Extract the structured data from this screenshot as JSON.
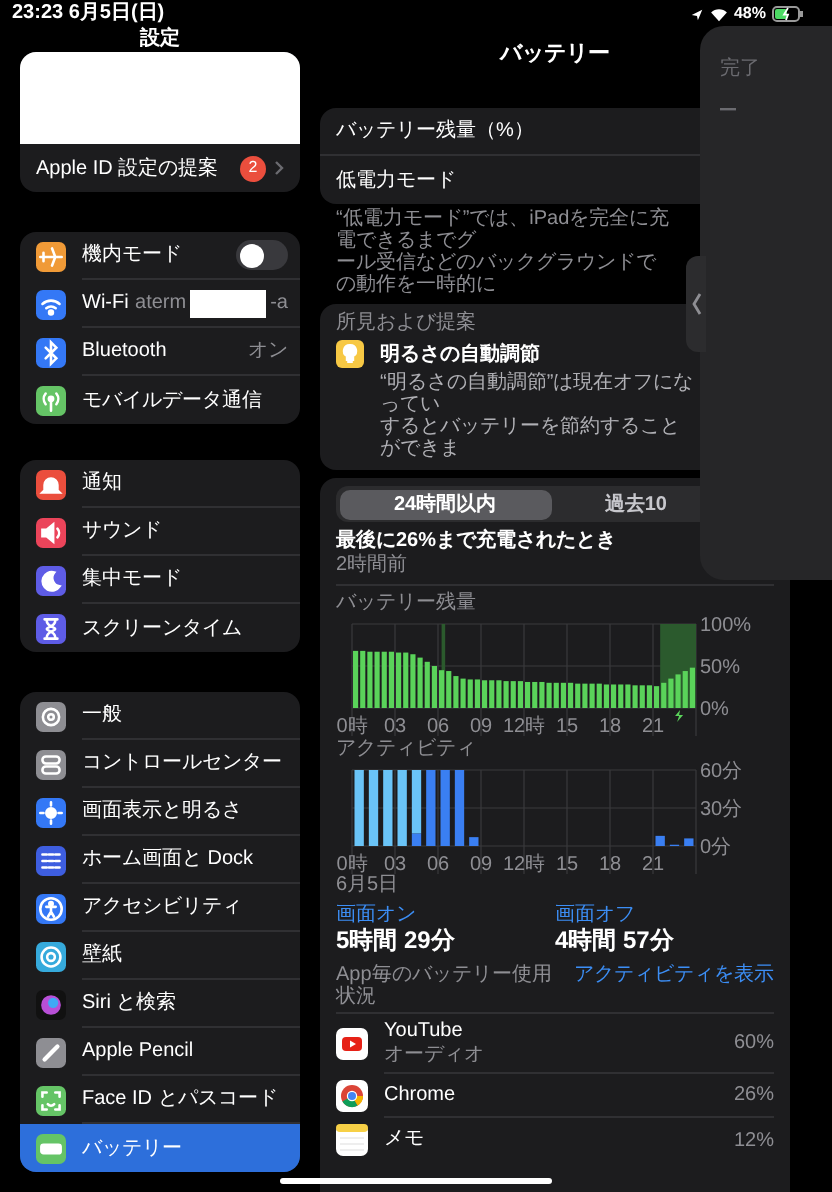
{
  "status_bar": {
    "datetime": "23:23 6月5日(日)",
    "battery": "48%"
  },
  "sidebar": {
    "title": "設定",
    "apple_id": {
      "label": "Apple ID 設定の提案",
      "badge": "2"
    },
    "groups": [
      {
        "items": [
          {
            "label": "機内モード",
            "kind": "toggle",
            "on": false,
            "selected": false
          },
          {
            "label": "Wi-Fi",
            "kind": "redacted_value",
            "value_start": "aterm",
            "value_end": "-a",
            "selected": false
          },
          {
            "label": "Bluetooth",
            "kind": "value",
            "value": "オン",
            "selected": false
          },
          {
            "label": "モバイルデータ通信",
            "kind": "plain",
            "selected": false
          }
        ]
      },
      {
        "items": [
          {
            "label": "通知",
            "kind": "plain",
            "selected": false
          },
          {
            "label": "サウンド",
            "kind": "plain",
            "selected": false
          },
          {
            "label": "集中モード",
            "kind": "plain",
            "selected": false
          },
          {
            "label": "スクリーンタイム",
            "kind": "plain",
            "selected": false
          }
        ]
      },
      {
        "items": [
          {
            "label": "一般",
            "kind": "plain",
            "selected": false
          },
          {
            "label": "コントロールセンター",
            "kind": "plain",
            "selected": false
          },
          {
            "label": "画面表示と明るさ",
            "kind": "plain",
            "selected": false
          },
          {
            "label": "ホーム画面と Dock",
            "kind": "plain",
            "selected": false
          },
          {
            "label": "アクセシビリティ",
            "kind": "plain",
            "selected": false
          },
          {
            "label": "壁紙",
            "kind": "plain",
            "selected": false
          },
          {
            "label": "Siri と検索",
            "kind": "plain",
            "selected": false
          },
          {
            "label": "Apple Pencil",
            "kind": "plain",
            "selected": false
          },
          {
            "label": "Face ID とパスコード",
            "kind": "plain",
            "selected": false
          },
          {
            "label": "バッテリー",
            "kind": "plain",
            "selected": true
          }
        ]
      }
    ]
  },
  "detail": {
    "title": "バッテリー",
    "settings": [
      {
        "label": "バッテリー残量（%）"
      },
      {
        "label": "低電力モード"
      }
    ],
    "low_power_note": [
      "“低電力モード”では、iPadを完全に充電できるまでグ",
      "ール受信などのバックグラウンドでの動作を一時的に"
    ],
    "insights": {
      "header": "所見および提案",
      "title": "明るさの自動調節",
      "text": [
        "“明るさの自動調節”は現在オフになってい",
        "するとバッテリーを節約することができま"
      ]
    },
    "usage": {
      "tabs": [
        {
          "label": "24時間以内",
          "selected": true
        },
        {
          "label": "過去10",
          "selected": false
        }
      ],
      "last_charge": "最後に26%まで充電されたとき",
      "last_charge_ago": "2時間前",
      "battery_level": {
        "chart_data": {
          "type": "bar",
          "title": "バッテリー残量",
          "grid": true,
          "xlim": [
            0,
            24
          ],
          "ylim": [
            0,
            100
          ],
          "x": [
            0.25,
            0.75,
            1.25,
            1.75,
            2.25,
            2.75,
            3.25,
            3.75,
            4.25,
            4.75,
            5.25,
            5.75,
            6.25,
            6.75,
            7.25,
            7.75,
            8.25,
            8.75,
            9.25,
            9.75,
            10.25,
            10.75,
            11.25,
            11.75,
            12.25,
            12.75,
            13.25,
            13.75,
            14.25,
            14.75,
            15.25,
            15.75,
            16.25,
            16.75,
            17.25,
            17.75,
            18.25,
            18.75,
            19.25,
            19.75,
            20.25,
            20.75,
            21.25,
            21.75,
            22.25,
            22.75,
            23.25,
            23.75
          ],
          "series": [
            {
              "color": "#5ad35a",
              "values": [
                68,
                68,
                67,
                67,
                67,
                67,
                66,
                66,
                64,
                60,
                55,
                50,
                45,
                44,
                38,
                35,
                34,
                34,
                33,
                33,
                33,
                32,
                32,
                32,
                31,
                31,
                31,
                30,
                30,
                30,
                30,
                29,
                29,
                29,
                29,
                28,
                28,
                28,
                28,
                27,
                27,
                27,
                26,
                30,
                35,
                40,
                44,
                48
              ]
            }
          ],
          "xticks": [
            {
              "value": 0,
              "label": "0時"
            },
            {
              "value": 3,
              "label": "03"
            },
            {
              "value": 6,
              "label": "06"
            },
            {
              "value": 9,
              "label": "09"
            },
            {
              "value": 12,
              "label": "12時"
            },
            {
              "value": 15,
              "label": "15"
            },
            {
              "value": 18,
              "label": "18"
            },
            {
              "value": 21,
              "label": "21"
            }
          ],
          "yticks": [
            {
              "value": 100,
              "label": "100%"
            },
            {
              "value": 50,
              "label": "50%"
            },
            {
              "value": 0,
              "label": "0%"
            }
          ],
          "bands": [
            {
              "axis": "x",
              "from": 6.25,
              "to": 6.5
            },
            {
              "axis": "x",
              "from": 21.5,
              "to": 24
            }
          ]
        }
      },
      "activity": {
        "date": "6月5日",
        "chart_data": {
          "type": "bar",
          "title": "アクティビティ",
          "grid": true,
          "stacked": true,
          "xlim": [
            0,
            24
          ],
          "ylim": [
            0,
            60
          ],
          "x": [
            0.5,
            1.5,
            2.5,
            3.5,
            4.5,
            5.5,
            6.5,
            7.5,
            8.5,
            21.5,
            22.5,
            23.5
          ],
          "series": [
            {
              "color": "#3a7ff2",
              "values": [
                0,
                0,
                0,
                0,
                10,
                60,
                60,
                60,
                7,
                8,
                1,
                6
              ]
            },
            {
              "color": "#6ac4f7",
              "values": [
                60,
                60,
                60,
                60,
                50,
                0,
                0,
                0,
                0,
                0,
                0,
                0
              ]
            }
          ],
          "xticks": [
            {
              "value": 0,
              "label": "0時"
            },
            {
              "value": 3,
              "label": "03"
            },
            {
              "value": 6,
              "label": "06"
            },
            {
              "value": 9,
              "label": "09"
            },
            {
              "value": 12,
              "label": "12時"
            },
            {
              "value": 15,
              "label": "15"
            },
            {
              "value": 18,
              "label": "18"
            },
            {
              "value": 21,
              "label": "21"
            }
          ],
          "yticks": [
            {
              "value": 60,
              "label": "60分"
            },
            {
              "value": 30,
              "label": "30分"
            },
            {
              "value": 0,
              "label": "0分"
            }
          ]
        }
      },
      "screen_on": {
        "label": "画面オン",
        "value": "5時間 29分"
      },
      "screen_off": {
        "label": "画面オフ",
        "value": "4時間 57分"
      },
      "apps_header": "App毎のバッテリー使用状況",
      "show_activity": "アクティビティを表示",
      "apps": [
        {
          "name": "YouTube",
          "detail": "オーディオ",
          "percent": "60%"
        },
        {
          "name": "Chrome",
          "percent": "26%"
        },
        {
          "name": "メモ",
          "percent": "12%"
        }
      ]
    }
  },
  "slide_over": {
    "done": "完了"
  }
}
